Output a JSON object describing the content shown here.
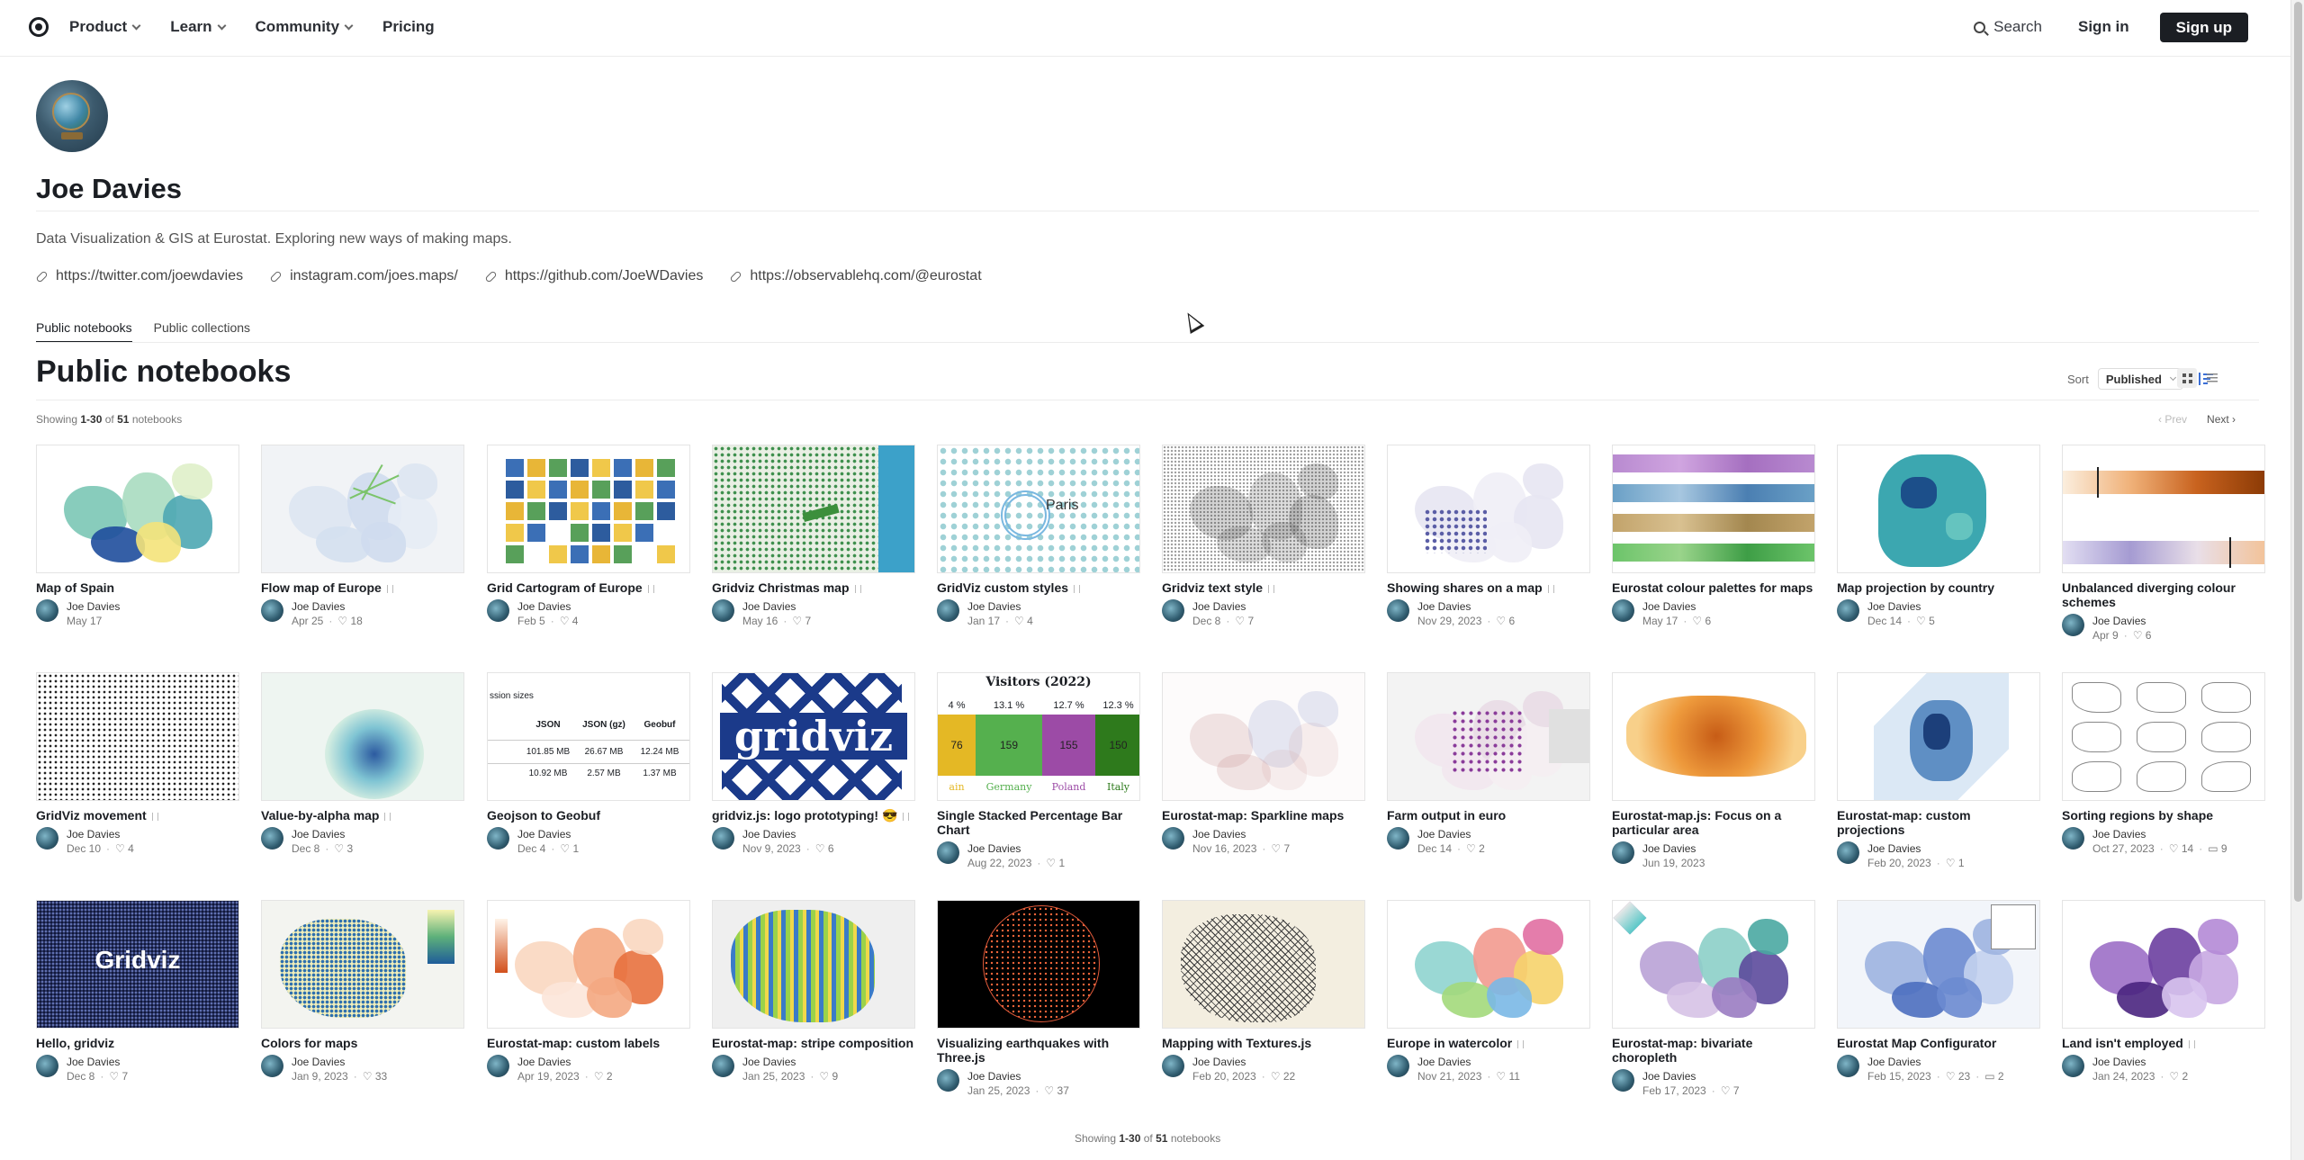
{
  "nav": {
    "items": [
      {
        "label": "Product",
        "dropdown": true
      },
      {
        "label": "Learn",
        "dropdown": true
      },
      {
        "label": "Community",
        "dropdown": true
      },
      {
        "label": "Pricing",
        "dropdown": false
      }
    ],
    "search_label": "Search",
    "signin_label": "Sign in",
    "signup_label": "Sign up"
  },
  "profile": {
    "name": "Joe Davies",
    "bio": "Data Visualization & GIS at Eurostat. Exploring new ways of making maps.",
    "links": [
      "https://twitter.com/joewdavies",
      "instagram.com/joes.maps/",
      "https://github.com/JoeWDavies",
      "https://observablehq.com/@eurostat"
    ]
  },
  "tabs": [
    {
      "label": "Public notebooks",
      "active": true
    },
    {
      "label": "Public collections",
      "active": false
    }
  ],
  "section_title": "Public notebooks",
  "sort": {
    "label": "Sort",
    "value": "Published"
  },
  "showing": {
    "prefix": "Showing",
    "range": "1-30",
    "of": "of",
    "total": "51",
    "suffix": "notebooks"
  },
  "pager": {
    "prev": "Prev",
    "next": "Next"
  },
  "notebooks": [
    {
      "title": "Map of Spain",
      "author": "Joe Davies",
      "date": "May 17",
      "likes": "",
      "comments": "",
      "forked": false,
      "thumb": "spain"
    },
    {
      "title": "Flow map of Europe",
      "author": "Joe Davies",
      "date": "Apr 25",
      "likes": "18",
      "comments": "",
      "forked": true,
      "thumb": "flow"
    },
    {
      "title": "Grid Cartogram of Europe",
      "author": "Joe Davies",
      "date": "Feb 5",
      "likes": "4",
      "comments": "",
      "forked": true,
      "thumb": "cartogram"
    },
    {
      "title": "Gridviz Christmas map",
      "author": "Joe Davies",
      "date": "May 16",
      "likes": "7",
      "comments": "",
      "forked": true,
      "thumb": "christmas"
    },
    {
      "title": "GridViz custom styles",
      "author": "Joe Davies",
      "date": "Jan 17",
      "likes": "4",
      "comments": "",
      "forked": true,
      "thumb": "custom"
    },
    {
      "title": "Gridviz text style",
      "author": "Joe Davies",
      "date": "Dec 8",
      "likes": "7",
      "comments": "",
      "forked": true,
      "thumb": "text"
    },
    {
      "title": "Showing shares on a map",
      "author": "Joe Davies",
      "date": "Nov 29, 2023",
      "likes": "6",
      "comments": "",
      "forked": true,
      "thumb": "shares"
    },
    {
      "title": "Eurostat colour palettes for maps",
      "author": "Joe Davies",
      "date": "May 17",
      "likes": "6",
      "comments": "",
      "forked": false,
      "thumb": "palettes"
    },
    {
      "title": "Map projection by country",
      "author": "Joe Davies",
      "date": "Dec 14",
      "likes": "5",
      "comments": "",
      "forked": false,
      "thumb": "france"
    },
    {
      "title": "Unbalanced diverging colour schemes",
      "author": "Joe Davies",
      "date": "Apr 9",
      "likes": "6",
      "comments": "",
      "forked": false,
      "thumb": "diverging"
    },
    {
      "title": "GridViz movement",
      "author": "Joe Davies",
      "date": "Dec 10",
      "likes": "4",
      "comments": "",
      "forked": true,
      "thumb": "movement"
    },
    {
      "title": "Value-by-alpha map",
      "author": "Joe Davies",
      "date": "Dec 8",
      "likes": "3",
      "comments": "",
      "forked": true,
      "thumb": "alpha"
    },
    {
      "title": "Geojson to Geobuf",
      "author": "Joe Davies",
      "date": "Dec 4",
      "likes": "1",
      "comments": "",
      "forked": false,
      "thumb": "geobuf"
    },
    {
      "title": "gridviz.js: logo prototyping! 😎",
      "author": "Joe Davies",
      "date": "Nov 9, 2023",
      "likes": "6",
      "comments": "",
      "forked": true,
      "thumb": "logo"
    },
    {
      "title": "Single Stacked Percentage Bar Chart",
      "author": "Joe Davies",
      "date": "Aug 22, 2023",
      "likes": "1",
      "comments": "",
      "forked": false,
      "thumb": "stacked"
    },
    {
      "title": "Eurostat-map: Sparkline maps",
      "author": "Joe Davies",
      "date": "Nov 16, 2023",
      "likes": "7",
      "comments": "",
      "forked": false,
      "thumb": "sparkline"
    },
    {
      "title": "Farm output in euro",
      "author": "Joe Davies",
      "date": "Dec 14",
      "likes": "2",
      "comments": "",
      "forked": false,
      "thumb": "farm"
    },
    {
      "title": "Eurostat-map.js: Focus on a particular area",
      "author": "Joe Davies",
      "date": "Jun 19, 2023",
      "likes": "",
      "comments": "",
      "forked": false,
      "thumb": "focus"
    },
    {
      "title": "Eurostat-map: custom projections",
      "author": "Joe Davies",
      "date": "Feb 20, 2023",
      "likes": "1",
      "comments": "",
      "forked": false,
      "thumb": "projections"
    },
    {
      "title": "Sorting regions by shape",
      "author": "Joe Davies",
      "date": "Oct 27, 2023",
      "likes": "14",
      "comments": "9",
      "forked": false,
      "thumb": "shapes"
    },
    {
      "title": "Hello, gridviz",
      "author": "Joe Davies",
      "date": "Dec 8",
      "likes": "7",
      "comments": "",
      "forked": false,
      "thumb": "hello"
    },
    {
      "title": "Colors for maps",
      "author": "Joe Davies",
      "date": "Jan 9, 2023",
      "likes": "33",
      "comments": "",
      "forked": false,
      "thumb": "colors"
    },
    {
      "title": "Eurostat-map: custom labels",
      "author": "Joe Davies",
      "date": "Apr 19, 2023",
      "likes": "2",
      "comments": "",
      "forked": false,
      "thumb": "labels"
    },
    {
      "title": "Eurostat-map: stripe composition",
      "author": "Joe Davies",
      "date": "Jan 25, 2023",
      "likes": "9",
      "comments": "",
      "forked": false,
      "thumb": "stripe"
    },
    {
      "title": "Visualizing earthquakes with Three.js",
      "author": "Joe Davies",
      "date": "Jan 25, 2023",
      "likes": "37",
      "comments": "",
      "forked": false,
      "thumb": "quakes"
    },
    {
      "title": "Mapping with Textures.js",
      "author": "Joe Davies",
      "date": "Feb 20, 2023",
      "likes": "22",
      "comments": "",
      "forked": false,
      "thumb": "textures"
    },
    {
      "title": "Europe in watercolor",
      "author": "Joe Davies",
      "date": "Nov 21, 2023",
      "likes": "11",
      "comments": "",
      "forked": true,
      "thumb": "watercolor"
    },
    {
      "title": "Eurostat-map: bivariate choropleth",
      "author": "Joe Davies",
      "date": "Feb 17, 2023",
      "likes": "7",
      "comments": "",
      "forked": false,
      "thumb": "bivariate"
    },
    {
      "title": "Eurostat Map Configurator",
      "author": "Joe Davies",
      "date": "Feb 15, 2023",
      "likes": "23",
      "comments": "2",
      "forked": false,
      "thumb": "configurator"
    },
    {
      "title": "Land isn't employed",
      "author": "Joe Davies",
      "date": "Jan 24, 2023",
      "likes": "2",
      "comments": "",
      "forked": true,
      "thumb": "land"
    }
  ],
  "thumb_text": {
    "christmas_label": "",
    "custom_label": "Paris",
    "logo": "gridviz",
    "hello": "Gridviz",
    "geobuf": {
      "caption": "ssion sizes",
      "headers": [
        "JSON",
        "JSON (gz)",
        "Geobuf"
      ],
      "rows": [
        [
          "101.85 MB",
          "26.67 MB",
          "12.24 MB"
        ],
        [
          "10.92 MB",
          "2.57 MB",
          "1.37 MB"
        ]
      ]
    },
    "stacked": {
      "title": "Visitors (2022)",
      "percents": [
        "4 %",
        "13.1 %",
        "12.7 %",
        "12.3 %"
      ],
      "values": [
        "76",
        "159",
        "155",
        "150"
      ],
      "countries": [
        "ain",
        "Germany",
        "Poland",
        "Italy"
      ]
    }
  },
  "footer_showing": {
    "prefix": "Showing",
    "range": "1-30",
    "of": "of",
    "total": "51",
    "suffix": "notebooks"
  }
}
